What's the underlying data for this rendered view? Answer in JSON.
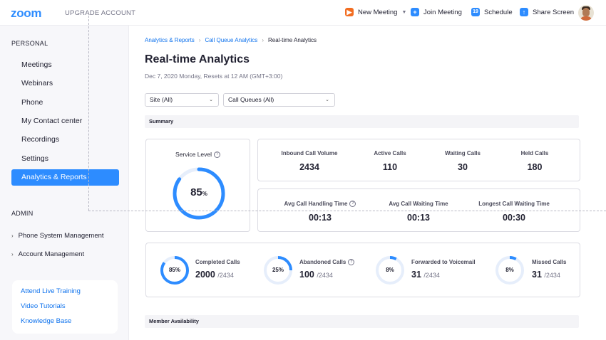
{
  "header": {
    "logo": "zoom",
    "upgrade": "UPGRADE ACCOUNT",
    "new_meeting": "New Meeting",
    "join_meeting": "Join Meeting",
    "schedule": "Schedule",
    "share_screen": "Share Screen",
    "new_meeting_color": "#f26d21",
    "accent": "#2d8cff"
  },
  "sidebar": {
    "personal_label": "PERSONAL",
    "items": [
      {
        "label": "Meetings"
      },
      {
        "label": "Webinars"
      },
      {
        "label": "Phone"
      },
      {
        "label": "My Contact center"
      },
      {
        "label": "Recordings"
      },
      {
        "label": "Settings"
      },
      {
        "label": "Analytics & Reports",
        "active": true
      }
    ],
    "admin_label": "ADMIN",
    "admin_items": [
      {
        "label": "Phone System Management"
      },
      {
        "label": "Account Management"
      }
    ],
    "help_links": [
      {
        "label": "Attend Live Training"
      },
      {
        "label": "Video Tutorials"
      },
      {
        "label": "Knowledge Base"
      }
    ]
  },
  "breadcrumb": [
    "Analytics & Reports",
    "Call Queue Analytics",
    "Real-time Analytics"
  ],
  "page": {
    "title": "Real-time Analytics",
    "subtitle": "Dec 7, 2020 Monday, Resets at 12 AM (GMT+3:00)"
  },
  "filters": {
    "site": "Site (All)",
    "queues": "Call Queues (All)"
  },
  "summary": {
    "heading": "Summary",
    "service_level": {
      "label": "Service Level",
      "value": "85",
      "unit": "%",
      "fraction": 0.85
    },
    "volume": [
      {
        "label": "Inbound Call Volume",
        "value": "2434"
      },
      {
        "label": "Active Calls",
        "value": "110"
      },
      {
        "label": "Waiting Calls",
        "value": "30"
      },
      {
        "label": "Held Calls",
        "value": "180"
      }
    ],
    "times": [
      {
        "label": "Avg Call Handling Time",
        "value": "00:13"
      },
      {
        "label": "Avg Call Waiting Time",
        "value": "00:13"
      },
      {
        "label": "Longest Call Waiting Time",
        "value": "00:30"
      }
    ],
    "completion": [
      {
        "label": "Completed Calls",
        "pct": "85%",
        "fraction": 0.85,
        "count": "2000",
        "total": "/2434"
      },
      {
        "label": "Abandoned Calls",
        "pct": "25%",
        "fraction": 0.25,
        "count": "100",
        "total": "/2434"
      },
      {
        "label": "Forwarded to Voicemail",
        "pct": "8%",
        "fraction": 0.08,
        "count": "31",
        "total": "/2434"
      },
      {
        "label": "Missed Calls",
        "pct": "8%",
        "fraction": 0.08,
        "count": "31",
        "total": "/2434"
      }
    ]
  },
  "availability": {
    "heading": "Member Availability"
  },
  "colors": {
    "ring_fill": "#2d8cff",
    "ring_track": "#e6eefb"
  }
}
